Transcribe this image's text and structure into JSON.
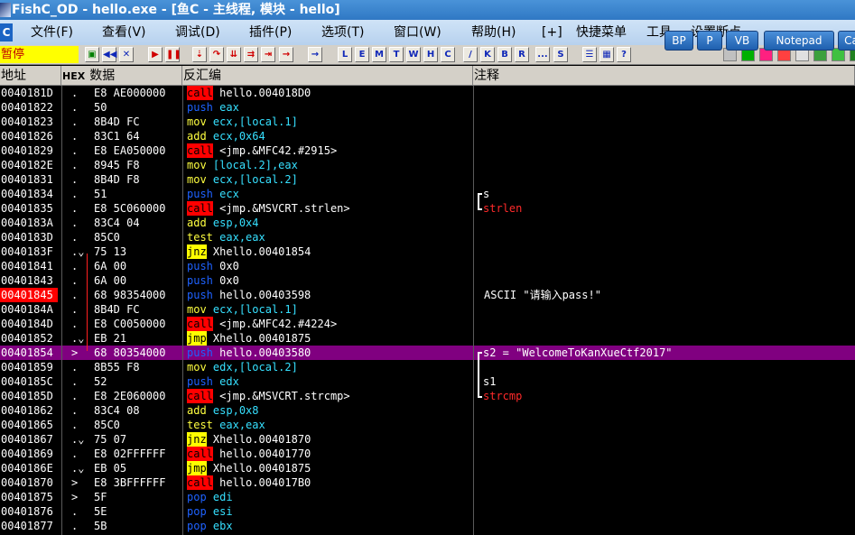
{
  "window": {
    "title": "FishC_OD - hello.exe - [鱼C - 主线程, 模块 - hello]"
  },
  "menu": {
    "badge": "C",
    "items": [
      "文件(F)",
      "查看(V)",
      "调试(D)",
      "插件(P)",
      "选项(T)",
      "窗口(W)",
      "帮助(H)",
      "[+]",
      "快捷菜单",
      "工具",
      "设置断点"
    ],
    "floating_buttons": [
      "BP",
      "P",
      "VB",
      "Notepad",
      "Ca"
    ]
  },
  "toolbar": {
    "status": "暂停",
    "letter_buttons": [
      "L",
      "E",
      "M",
      "T",
      "W",
      "H",
      "C",
      "/",
      "K",
      "B",
      "R",
      "...",
      "S"
    ]
  },
  "columns": {
    "address": "地址",
    "hex_tag": "HEX",
    "data": "数据",
    "disasm": "反汇编",
    "comment": "注释"
  },
  "colors": {
    "call_bg": "#ff0000",
    "jmp_bg": "#ffff00",
    "selected_row": "#800080",
    "highlight_addr": "#ff0000"
  },
  "rows": [
    {
      "addr": "0040181D",
      "mark": ".",
      "bytes": "E8 AE000000",
      "mn": "call",
      "op": "hello.004018D0",
      "comment": ""
    },
    {
      "addr": "00401822",
      "mark": ".",
      "bytes": "50",
      "mn": "push",
      "op": "eax",
      "comment": ""
    },
    {
      "addr": "00401823",
      "mark": ".",
      "bytes": "8B4D FC",
      "mn": "mov",
      "op": "ecx,[local.1]",
      "comment": ""
    },
    {
      "addr": "00401826",
      "mark": ".",
      "bytes": "83C1 64",
      "mn": "add",
      "op": "ecx,0x64",
      "comment": ""
    },
    {
      "addr": "00401829",
      "mark": ".",
      "bytes": "E8 EA050000",
      "mn": "call",
      "op": "<jmp.&MFC42.#2915>",
      "comment": ""
    },
    {
      "addr": "0040182E",
      "mark": ".",
      "bytes": "8945 F8",
      "mn": "mov",
      "op": "[local.2],eax",
      "comment": ""
    },
    {
      "addr": "00401831",
      "mark": ".",
      "bytes": "8B4D F8",
      "mn": "mov",
      "op": "ecx,[local.2]",
      "comment": ""
    },
    {
      "addr": "00401834",
      "mark": ".",
      "bytes": "51",
      "mn": "push",
      "op": "ecx",
      "comment": "s"
    },
    {
      "addr": "00401835",
      "mark": ".",
      "bytes": "E8 5C060000",
      "mn": "call",
      "op": "<jmp.&MSVCRT.strlen>",
      "comment": "strlen"
    },
    {
      "addr": "0040183A",
      "mark": ".",
      "bytes": "83C4 04",
      "mn": "add",
      "op": "esp,0x4",
      "comment": ""
    },
    {
      "addr": "0040183D",
      "mark": ".",
      "bytes": "85C0",
      "mn": "test",
      "op": "eax,eax",
      "comment": ""
    },
    {
      "addr": "0040183F",
      "mark": ".⌄",
      "bytes": "75 13",
      "mn": "jnz",
      "op": "Xhello.00401854",
      "comment": ""
    },
    {
      "addr": "00401841",
      "mark": ".",
      "bytes": "6A 00",
      "mn": "push",
      "op": "0x0",
      "comment": ""
    },
    {
      "addr": "00401843",
      "mark": ".",
      "bytes": "6A 00",
      "mn": "push",
      "op": "0x0",
      "comment": ""
    },
    {
      "addr": "00401845",
      "mark": ".",
      "bytes": "68 98354000",
      "mn": "push",
      "op": "hello.00403598",
      "comment": "ASCII \"请输入pass!\""
    },
    {
      "addr": "0040184A",
      "mark": ".",
      "bytes": "8B4D FC",
      "mn": "mov",
      "op": "ecx,[local.1]",
      "comment": ""
    },
    {
      "addr": "0040184D",
      "mark": ".",
      "bytes": "E8 C0050000",
      "mn": "call",
      "op": "<jmp.&MFC42.#4224>",
      "comment": ""
    },
    {
      "addr": "00401852",
      "mark": ".⌄",
      "bytes": "EB 21",
      "mn": "jmp",
      "op": "Xhello.00401875",
      "comment": ""
    },
    {
      "addr": "00401854",
      "mark": ">",
      "bytes": "68 80354000",
      "mn": "push",
      "op": "hello.00403580",
      "comment": "s2 = \"WelcomeToKanXueCtf2017\""
    },
    {
      "addr": "00401859",
      "mark": ".",
      "bytes": "8B55 F8",
      "mn": "mov",
      "op": "edx,[local.2]",
      "comment": ""
    },
    {
      "addr": "0040185C",
      "mark": ".",
      "bytes": "52",
      "mn": "push",
      "op": "edx",
      "comment": "s1"
    },
    {
      "addr": "0040185D",
      "mark": ".",
      "bytes": "E8 2E060000",
      "mn": "call",
      "op": "<jmp.&MSVCRT.strcmp>",
      "comment": "strcmp"
    },
    {
      "addr": "00401862",
      "mark": ".",
      "bytes": "83C4 08",
      "mn": "add",
      "op": "esp,0x8",
      "comment": ""
    },
    {
      "addr": "00401865",
      "mark": ".",
      "bytes": "85C0",
      "mn": "test",
      "op": "eax,eax",
      "comment": ""
    },
    {
      "addr": "00401867",
      "mark": ".⌄",
      "bytes": "75 07",
      "mn": "jnz",
      "op": "Xhello.00401870",
      "comment": ""
    },
    {
      "addr": "00401869",
      "mark": ".",
      "bytes": "E8 02FFFFFF",
      "mn": "call",
      "op": "hello.00401770",
      "comment": ""
    },
    {
      "addr": "0040186E",
      "mark": ".⌄",
      "bytes": "EB 05",
      "mn": "jmp",
      "op": "Xhello.00401875",
      "comment": ""
    },
    {
      "addr": "00401870",
      "mark": ">",
      "bytes": "E8 3BFFFFFF",
      "mn": "call",
      "op": "hello.004017B0",
      "comment": ""
    },
    {
      "addr": "00401875",
      "mark": ">",
      "bytes": "5F",
      "mn": "pop",
      "op": "edi",
      "comment": ""
    },
    {
      "addr": "00401876",
      "mark": ".",
      "bytes": "5E",
      "mn": "pop",
      "op": "esi",
      "comment": ""
    },
    {
      "addr": "00401877",
      "mark": ".",
      "bytes": "5B",
      "mn": "pop",
      "op": "ebx",
      "comment": ""
    }
  ],
  "selected_addr": "00401854",
  "highlighted_addr": "00401845",
  "red_comments": [
    "strlen",
    "strcmp"
  ]
}
